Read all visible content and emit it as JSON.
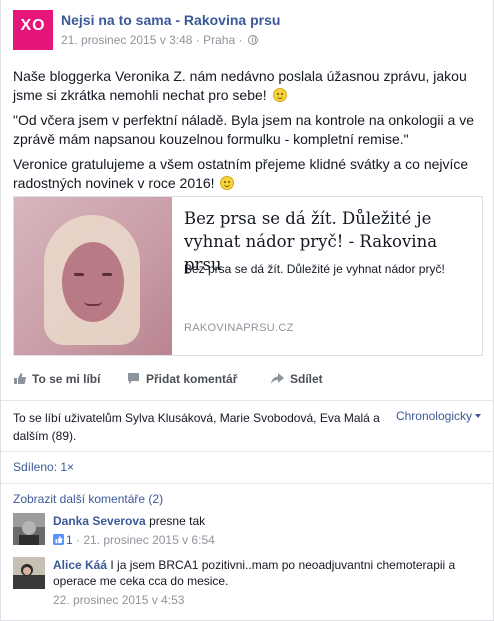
{
  "post": {
    "page_name": "Nejsi na to sama - Rakovina prsu",
    "timestamp": "21. prosinec 2015 v 3:48",
    "separator": " · ",
    "location": "Praha",
    "avatar_text": "XO",
    "paragraphs": [
      "Naše bloggerka Veronika Z. nám nedávno poslala úžasnou zprávu, jakou jsme si zkrátka nemohli nechat pro sebe!",
      "\"Od včera jsem v perfektní náladě. Byla jsem na kontrole na onkologii a ve zprávě mám napsanou kouzelnou formulku - kompletní remise.\"",
      "Veronice gratulujeme a všem ostatním přejeme klidné svátky a co nejvíce radostných novinek v roce 2016!"
    ]
  },
  "link_preview": {
    "title": "Bez prsa se dá žít. Důležité je vyhnat nádor pryč! - Rakovina prsu",
    "description": "Bez prsa se dá žít. Důležité je vyhnat nádor pryč!",
    "domain": "RAKOVINAPRSU.CZ"
  },
  "actions": {
    "like": "To se mi líbí",
    "comment": "Přidat komentář",
    "share": "Sdílet"
  },
  "likes_summary": "To se líbí uživatelům Sylva Klusáková, Marie Svobodová, Eva Malá a dalším (89).",
  "sort_label": "Chronologicky",
  "shares_label": "Sdíleno: 1×",
  "more_comments": "Zobrazit další komentáře (2)",
  "comments": [
    {
      "name": "Danka Severova",
      "text": "presne tak",
      "likes": "1",
      "time": "21. prosinec 2015 v 6:54"
    },
    {
      "name": "Alice Káá",
      "text": "I ja jsem BRCA1 pozitivni..mam po neoadjuvantni chemoterapii a operace me ceka cca do mesice.",
      "time": "22. prosinec 2015 v 4:53"
    }
  ],
  "colors": {
    "brand": "#e5157a",
    "link": "#3b5998",
    "muted": "#90949c"
  }
}
